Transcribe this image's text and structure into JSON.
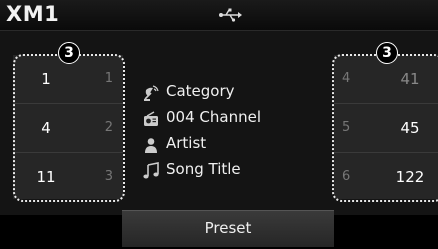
{
  "header": {
    "title": "XM1",
    "usb_icon": "usb-icon"
  },
  "left_presets": [
    {
      "channel": "1",
      "index": "1"
    },
    {
      "channel": "4",
      "index": "2"
    },
    {
      "channel": "11",
      "index": "3"
    }
  ],
  "right_presets": [
    {
      "index": "4",
      "channel": "41"
    },
    {
      "index": "5",
      "channel": "45"
    },
    {
      "index": "6",
      "channel": "122"
    }
  ],
  "callouts": {
    "left": "3",
    "right": "3"
  },
  "info": {
    "category": "Category",
    "channel": "004 Channel",
    "artist": "Artist",
    "song_title": "Song Title"
  },
  "footer": {
    "preset_label": "Preset"
  }
}
